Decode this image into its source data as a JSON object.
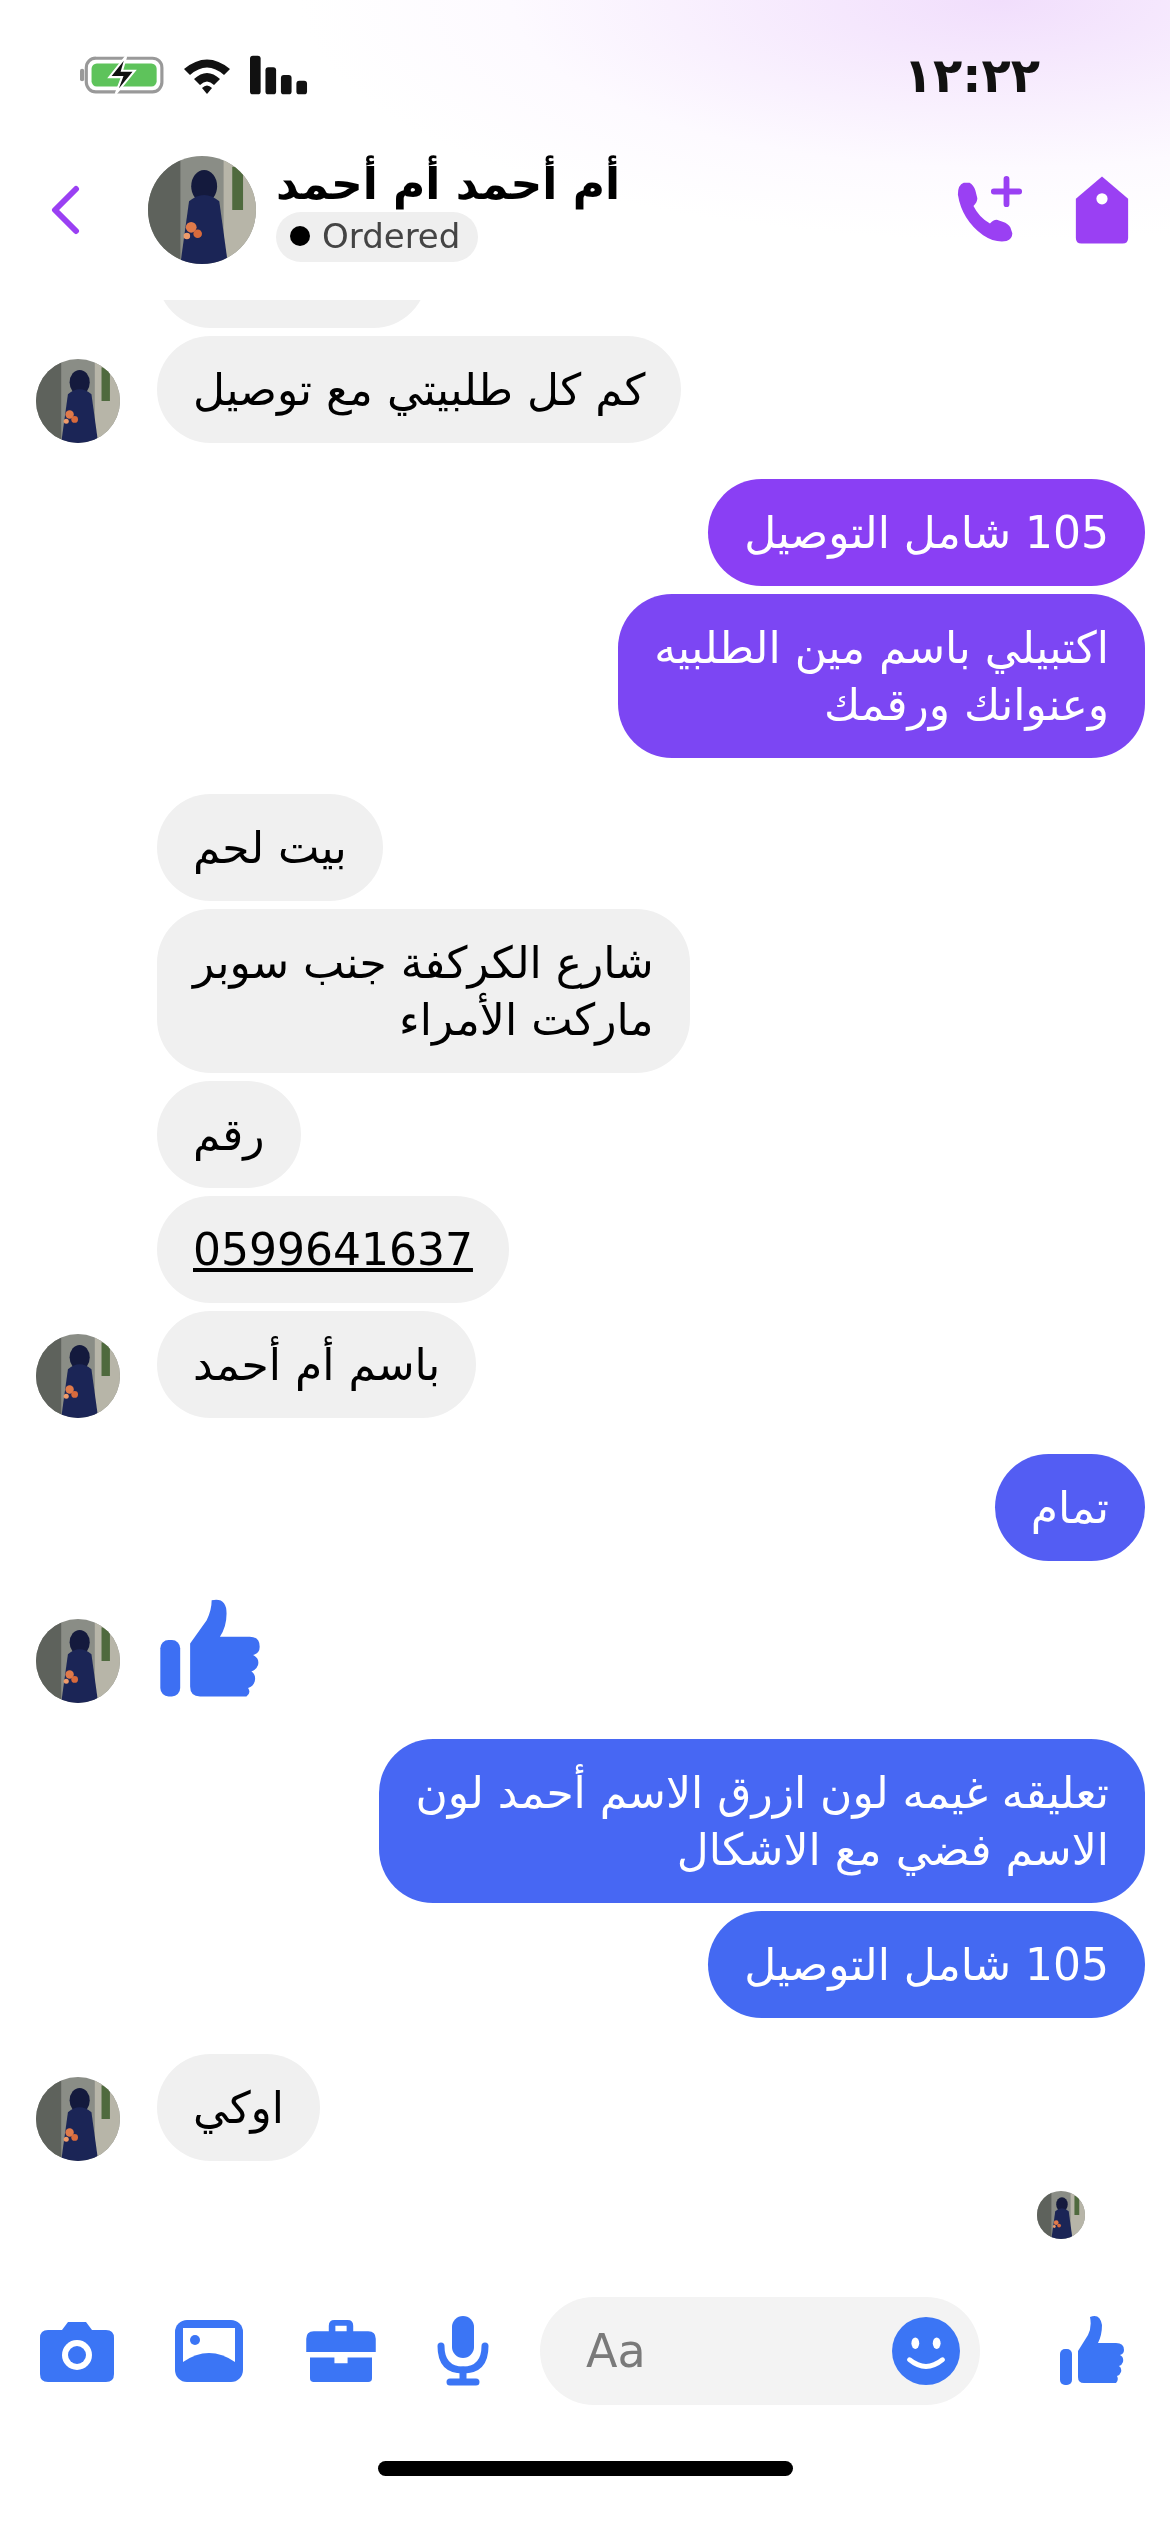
{
  "status_bar": {
    "time": "١٢:٢٢",
    "charging": true
  },
  "header": {
    "name": "أم أحمد أم أحمد",
    "label": "Ordered"
  },
  "groups": [
    {
      "kind": "received",
      "avatar": true,
      "messages": [
        {
          "kind": "cut"
        },
        {
          "kind": "text",
          "text": "كم كل طلبيتي مع توصيل"
        }
      ]
    },
    {
      "kind": "sent",
      "messages": [
        {
          "kind": "text",
          "text": "105 شامل التوصيل",
          "color": "#8a3ff4"
        },
        {
          "kind": "text",
          "text": "اكتبيلي باسم مين الطلبيه\nوعنوانك ورقمك",
          "color": "#7c46f3"
        }
      ]
    },
    {
      "kind": "received",
      "avatar": true,
      "messages": [
        {
          "kind": "text",
          "text": "بيت لحم"
        },
        {
          "kind": "text",
          "text": "شارع الكركفة جنب سوبر\nماركت الأمراء"
        },
        {
          "kind": "text",
          "text": "رقم"
        },
        {
          "kind": "link",
          "text": "0599641637"
        },
        {
          "kind": "text",
          "text": "باسم أم أحمد"
        }
      ]
    },
    {
      "kind": "sent",
      "messages": [
        {
          "kind": "text",
          "text": "تمام",
          "color": "#535df3"
        }
      ]
    },
    {
      "kind": "received",
      "avatar": true,
      "messages": [
        {
          "kind": "like"
        }
      ]
    },
    {
      "kind": "sent",
      "messages": [
        {
          "kind": "text",
          "text": "تعليقه غيمه لون ازرق الاسم أحمد لون\nالاسم فضي مع الاشكال",
          "color": "#4767f3"
        },
        {
          "kind": "text",
          "text": "105 شامل التوصيل",
          "color": "#4469f2"
        }
      ]
    },
    {
      "kind": "received",
      "avatar": true,
      "messages": [
        {
          "kind": "text",
          "text": "اوكي"
        }
      ]
    }
  ],
  "seen": true,
  "composer": {
    "placeholder": "Aa"
  }
}
